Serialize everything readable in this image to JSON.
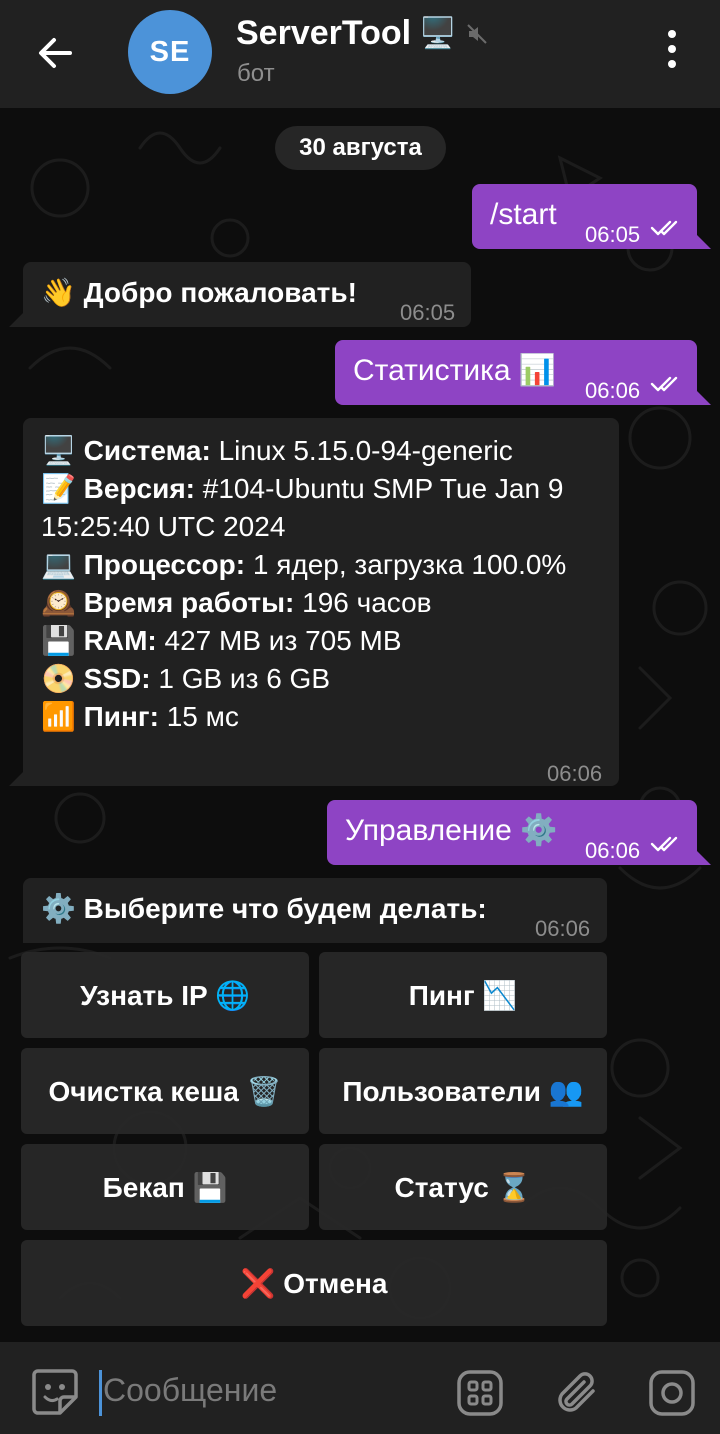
{
  "header": {
    "avatar_initials": "SE",
    "title": "ServerTool",
    "title_emoji": "🖥️",
    "subtitle": "бот"
  },
  "chat": {
    "date": "30 августа",
    "messages": {
      "m1": {
        "text": "/start",
        "time": "06:05",
        "direction": "out"
      },
      "m2": {
        "text": "👋 Добро пожаловать!",
        "time": "06:05",
        "direction": "in"
      },
      "m3": {
        "text": "Статистика 📊",
        "time": "06:06",
        "direction": "out"
      },
      "m4": {
        "time": "06:06",
        "direction": "in",
        "lines": [
          {
            "emoji": "🖥️",
            "label": "Система:",
            "value": "Linux 5.15.0-94-generic"
          },
          {
            "emoji": "📝",
            "label": "Версия:",
            "value": "#104-Ubuntu SMP Tue Jan 9 15:25:40 UTC 2024"
          },
          {
            "emoji": "💻",
            "label": "Процессор:",
            "value": "1 ядер, загрузка 100.0%"
          },
          {
            "emoji": "🕰️",
            "label": "Время работы:",
            "value": "196 часов"
          },
          {
            "emoji": "💾",
            "label": "RAM:",
            "value": "427 MB из 705 MB"
          },
          {
            "emoji": "📀",
            "label": "SSD:",
            "value": "1 GB из 6 GB"
          },
          {
            "emoji": "📶",
            "label": "Пинг:",
            "value": "15 мс"
          }
        ]
      },
      "m5": {
        "text": "Управление ⚙️",
        "time": "06:06",
        "direction": "out"
      },
      "m6": {
        "text": "⚙️ Выберите что будем делать:",
        "time": "06:06",
        "direction": "in"
      }
    },
    "keyboard": {
      "ip": "Узнать IP 🌐",
      "ping": "Пинг 📉",
      "cache": "Очистка кеша 🗑️",
      "users": "Пользователи 👥",
      "backup": "Бекап 💾",
      "status": "Статус ⌛",
      "cancel": "❌ Отмена"
    }
  },
  "input": {
    "placeholder": "Сообщение"
  },
  "colors": {
    "outgoing_bubble": "#8e44c4",
    "incoming_bubble": "#212121",
    "header_bg": "#212121",
    "avatar": "#4c93d9"
  },
  "icons": [
    "back-arrow-icon",
    "mute-icon",
    "more-vert-icon",
    "double-check-icon",
    "sticker-icon",
    "bot-commands-icon",
    "attach-icon",
    "camera-icon"
  ]
}
